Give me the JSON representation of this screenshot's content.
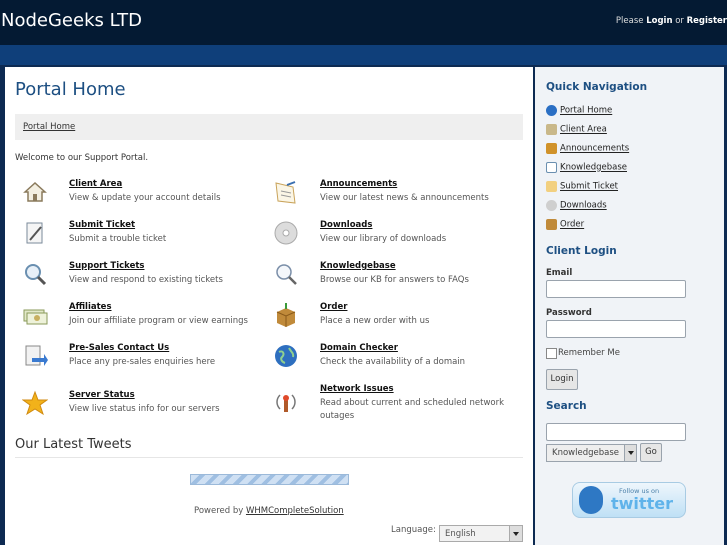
{
  "header": {
    "brand": "NodeGeeks LTD",
    "please": "Please",
    "login": "Login",
    "or": "or",
    "register": "Register"
  },
  "main": {
    "title": "Portal Home",
    "breadcrumb": "Portal Home",
    "welcome": "Welcome to our Support Portal.",
    "items": [
      {
        "title": "Client Area",
        "desc": "View & update your account details",
        "icon": "house-icon",
        "color": "#8a7a5c"
      },
      {
        "title": "Announcements",
        "desc": "View our latest news & announcements",
        "icon": "announcement-paper-icon",
        "color": "#c9a35a"
      },
      {
        "title": "Submit Ticket",
        "desc": "Submit a trouble ticket",
        "icon": "notepad-pen-icon",
        "color": "#7a8a9a"
      },
      {
        "title": "Downloads",
        "desc": "View our library of downloads",
        "icon": "cd-disc-icon",
        "color": "#b8b8b8"
      },
      {
        "title": "Support Tickets",
        "desc": "View and respond to existing tickets",
        "icon": "magnifier-icon",
        "color": "#6a8fb0"
      },
      {
        "title": "Knowledgebase",
        "desc": "Browse our KB for answers to FAQs",
        "icon": "magnifier-icon",
        "color": "#7a8ea8"
      },
      {
        "title": "Affiliates",
        "desc": "Join our affiliate program or view earnings",
        "icon": "money-icon",
        "color": "#a3b07a"
      },
      {
        "title": "Order",
        "desc": "Place a new order with us",
        "icon": "package-box-icon",
        "color": "#c08a3a"
      },
      {
        "title": "Pre-Sales Contact Us",
        "desc": "Place any pre-sales enquiries here",
        "icon": "document-arrow-icon",
        "color": "#3a7ad0"
      },
      {
        "title": "Domain Checker",
        "desc": "Check the availability of a domain",
        "icon": "globe-icon",
        "color": "#2e6fbf"
      },
      {
        "title": "Server Status",
        "desc": "View live status info for our servers",
        "icon": "star-icon",
        "color": "#f2b21a"
      },
      {
        "title": "Network Issues",
        "desc": "Read about current and scheduled network outages",
        "icon": "broadcast-antenna-icon",
        "color": "#b05a2a"
      }
    ],
    "tweets_heading": "Our Latest Tweets",
    "powered_by": "Powered by",
    "powered_link": "WHMCompleteSolution",
    "language_label": "Language:",
    "language_value": "English"
  },
  "sidebar": {
    "quick_nav_heading": "Quick Navigation",
    "quick_nav": [
      {
        "label": "Portal Home",
        "icon": "home-globe-icon",
        "color": "#2a6fc4"
      },
      {
        "label": "Client Area",
        "icon": "house-icon",
        "color": "#8a7a5c"
      },
      {
        "label": "Announcements",
        "icon": "announcement-icon",
        "color": "#d0922a"
      },
      {
        "label": "Knowledgebase",
        "icon": "magnifier-icon",
        "color": "#6a8fb0"
      },
      {
        "label": "Submit Ticket",
        "icon": "notepad-pen-icon",
        "color": "#d0a040"
      },
      {
        "label": "Downloads",
        "icon": "cd-disc-icon",
        "color": "#9a9a9a"
      },
      {
        "label": "Order",
        "icon": "package-box-icon",
        "color": "#c08a3a"
      }
    ],
    "client_login_heading": "Client Login",
    "email_label": "Email",
    "password_label": "Password",
    "remember_label": "Remember Me",
    "login_button": "Login",
    "search_heading": "Search",
    "search_scope": "Knowledgebase",
    "go_button": "Go",
    "twitter_small": "Follow us on",
    "twitter_big": "twitter"
  }
}
